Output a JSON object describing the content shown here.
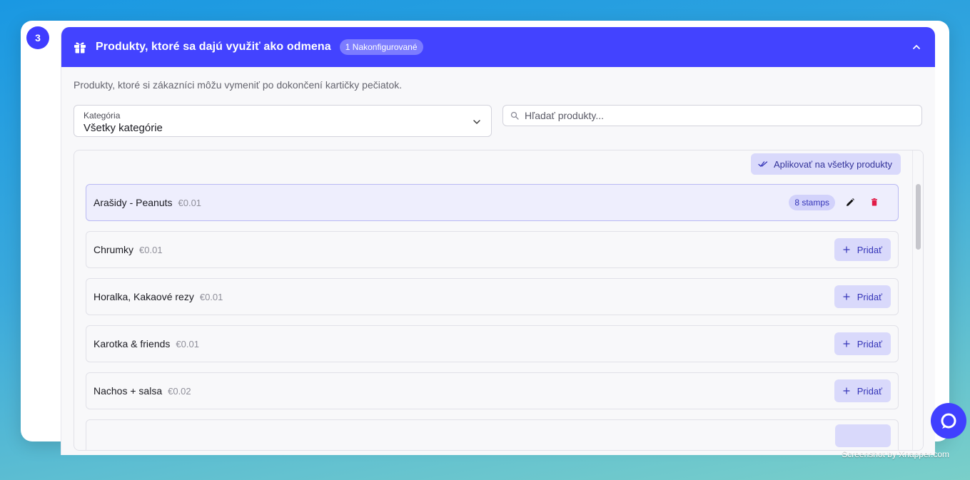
{
  "step": {
    "number": "3"
  },
  "section": {
    "title": "Produkty, ktoré sa dajú využiť ako odmena",
    "configured_badge": "1 Nakonfigurované",
    "description": "Produkty, ktoré si zákazníci môžu vymeniť po dokončení kartičky pečiatok."
  },
  "filters": {
    "category_label": "Kategória",
    "category_value": "Všetky kategórie",
    "search_placeholder": "Hľadať produkty...",
    "search_value": ""
  },
  "apply_all_label": "Aplikovať na všetky produkty",
  "products": [
    {
      "name": "Arašidy - Peanuts",
      "price": "€0.01",
      "stamps": "8 stamps",
      "selected": true
    },
    {
      "name": "Chrumky",
      "price": "€0.01",
      "action": "Pridať"
    },
    {
      "name": "Horalka, Kakaové rezy",
      "price": "€0.01",
      "action": "Pridať"
    },
    {
      "name": "Karotka & friends",
      "price": "€0.01",
      "action": "Pridať"
    },
    {
      "name": "Nachos + salsa",
      "price": "€0.02",
      "action": "Pridať"
    }
  ],
  "watermark": "Screenshot by Xnapper.com",
  "colors": {
    "accent": "#4343ff",
    "accent_light": "#d9d9fb",
    "delete": "#e11d48"
  }
}
